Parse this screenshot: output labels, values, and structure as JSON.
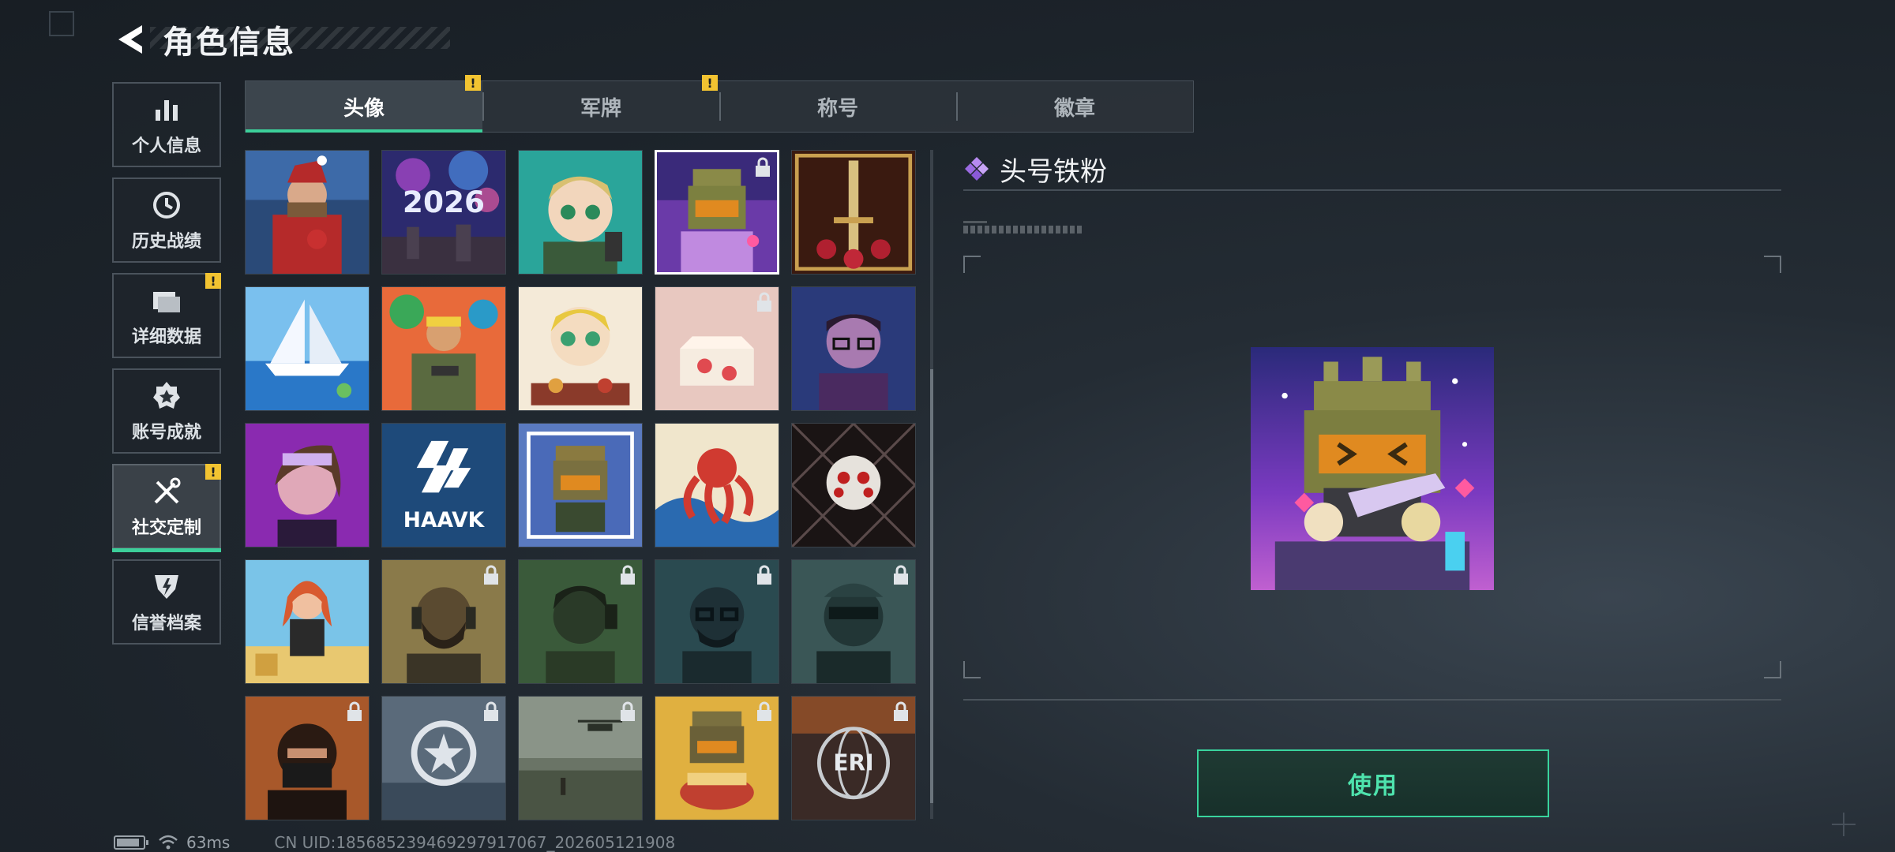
{
  "header": {
    "title": "角色信息",
    "back_icon": "back-arrow-icon"
  },
  "sidebar": {
    "items": [
      {
        "label": "个人信息",
        "icon": "bar-chart-icon",
        "badge": ""
      },
      {
        "label": "历史战绩",
        "icon": "clock-history-icon",
        "badge": ""
      },
      {
        "label": "详细数据",
        "icon": "folder-icon",
        "badge": "!"
      },
      {
        "label": "账号成就",
        "icon": "achievement-medal-icon",
        "badge": ""
      },
      {
        "label": "社交定制",
        "icon": "tools-icon",
        "badge": "!",
        "active": true
      },
      {
        "label": "信誉档案",
        "icon": "reputation-shield-icon",
        "badge": ""
      }
    ]
  },
  "tabs": [
    {
      "label": "头像",
      "badge": "!",
      "active": true
    },
    {
      "label": "军牌",
      "badge": "!"
    },
    {
      "label": "称号",
      "badge": ""
    },
    {
      "label": "徽章",
      "badge": ""
    }
  ],
  "avatar_grid": {
    "columns": 5,
    "selected_index": 3,
    "items": [
      {
        "name": "santa-soldier-avatar",
        "locked": false
      },
      {
        "name": "fireworks-2026-avatar",
        "locked": false
      },
      {
        "name": "anime-soldier-avatar",
        "locked": false
      },
      {
        "name": "iron-fan-mascot-avatar",
        "locked": true
      },
      {
        "name": "golden-sword-roses-avatar",
        "locked": false
      },
      {
        "name": "sailboat-avatar",
        "locked": false
      },
      {
        "name": "tropical-soldier-avatar",
        "locked": false
      },
      {
        "name": "chibi-eating-avatar",
        "locked": false
      },
      {
        "name": "strawberry-cake-avatar",
        "locked": true
      },
      {
        "name": "glasses-man-avatar",
        "locked": false
      },
      {
        "name": "purple-woman-avatar",
        "locked": false
      },
      {
        "name": "haavk-logo-avatar",
        "locked": false
      },
      {
        "name": "mascot-sticker-avatar",
        "locked": false
      },
      {
        "name": "octopus-wave-avatar",
        "locked": false
      },
      {
        "name": "jigsaw-puppet-avatar",
        "locked": false
      },
      {
        "name": "beach-woman-avatar",
        "locked": false
      },
      {
        "name": "bearded-operator-avatar",
        "locked": true
      },
      {
        "name": "headset-operator-avatar",
        "locked": true
      },
      {
        "name": "glasses-operator-avatar",
        "locked": true
      },
      {
        "name": "masked-operator-avatar",
        "locked": true
      },
      {
        "name": "hooded-fighter-avatar",
        "locked": true
      },
      {
        "name": "star-emblem-avatar",
        "locked": true
      },
      {
        "name": "helicopter-field-avatar",
        "locked": true
      },
      {
        "name": "mascot-ramen-avatar",
        "locked": true
      },
      {
        "name": "eri-globe-avatar",
        "locked": true
      }
    ],
    "haavk_text": "HAAVK",
    "fireworks_text": "2026",
    "eri_text": "ERI"
  },
  "detail": {
    "title": "头号铁粉",
    "title_icon": "diamond-cluster-icon",
    "use_button": "使用"
  },
  "status_bar": {
    "battery_icon": "battery-icon",
    "wifi_icon": "wifi-icon",
    "ping": "63ms",
    "uid": "CN UID:185685239469297917067_202605121908"
  },
  "colors": {
    "accent": "#3ccf9a",
    "badge": "#f2c331",
    "button_text": "#4ee3ad"
  }
}
